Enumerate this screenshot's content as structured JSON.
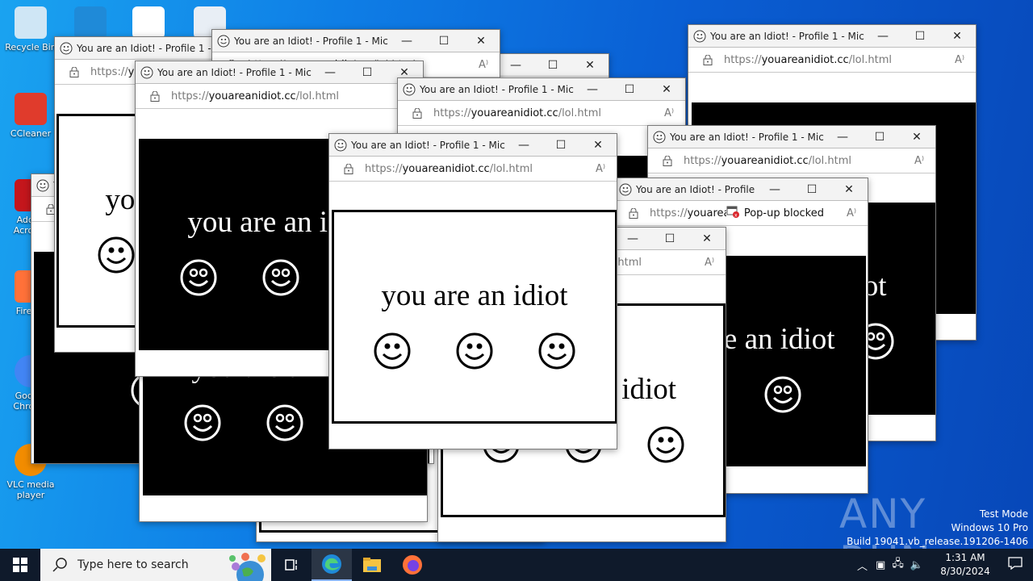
{
  "desktop": {
    "icons": [
      {
        "label": "Recycle Bin",
        "name": "recycle-bin"
      },
      {
        "label": "",
        "name": "microsoft-edge"
      },
      {
        "label": "",
        "name": "word-document"
      },
      {
        "label": "",
        "name": "image-file"
      },
      {
        "label": "CCleaner",
        "name": "ccleaner"
      },
      {
        "label": "Adobe Acrobat",
        "name": "adobe-acrobat"
      },
      {
        "label": "Firefox",
        "name": "firefox"
      },
      {
        "label": "Google Chrome",
        "name": "google-chrome"
      },
      {
        "label": "VLC media player",
        "name": "vlc-media-player"
      }
    ]
  },
  "windows": [
    {
      "title": "You are an Idiot! - Profile 1 - Micro...",
      "url_scheme": "https://",
      "url_domain": "youareanidiot.cc",
      "url_path": "/lol.html",
      "theme": "white",
      "text": "you are an idiot",
      "smileys": 3
    },
    {
      "title": "You are an Idiot! - Profile 1 - Micro...",
      "url_scheme": "https://",
      "url_domain": "youareanidiot.cc",
      "url_path": "/lol.html",
      "theme": "black",
      "text": "you are an idiot",
      "smileys": 3
    },
    {
      "title": "You are an Idiot! - Profile 1 - Micro...",
      "url_scheme": "https://",
      "url_domain": "youareanidiot.cc",
      "url_path": "/lol.html",
      "theme": "black",
      "text": "you are an idiot",
      "smileys": 3
    },
    {
      "title": "You are an Idiot! - Profile 1 - Micro...",
      "url_scheme": "https://",
      "url_domain": "youareanidiot.cc",
      "url_path": "/lol.html",
      "theme": "white",
      "text": "you are an idiot",
      "smileys": 3
    },
    {
      "title": "You are an Idiot! - Profile 1 - Micro...",
      "url_scheme": "https://",
      "url_domain": "youareanidiot.cc",
      "url_path": "/lol.html",
      "theme": "white",
      "text": "you are an idiot",
      "smileys": 3
    },
    {
      "title": "You are an Idiot! - Profile 1 - Micro...",
      "url_scheme": "https://",
      "url_domain": "youareanidiot.cc",
      "url_path": "/lol.html",
      "theme": "black",
      "text": "you are an idiot",
      "smileys": 3
    },
    {
      "title": "You are an Idiot! - Profile 1 - Micro...",
      "url_scheme": "https://",
      "url_domain": "youareanidiot.cc",
      "url_path": "/lol.html",
      "theme": "black",
      "text": "you are an idiot",
      "smileys": 3
    },
    {
      "title": "You are an Idiot! - Profile 1 - Micro...",
      "url_scheme": "https://",
      "url_domain": "youareanidiot.cc",
      "url_path": "/lol.html",
      "theme": "black",
      "text": "you are an idiot",
      "smileys": 3
    },
    {
      "title": "You are an Idiot! - Profile 1 - Micro...",
      "url_scheme": "https://",
      "url_domain": "youareanidiot.cc",
      "url_path": "/lol.html",
      "theme": "black",
      "text": "you are an idiot",
      "smileys": 3
    },
    {
      "title": "You are an Idiot! - Profile 1 - Micro...",
      "url_scheme": "https://",
      "url_domain": "youareanidiot.cc",
      "url_path": "/lol.html",
      "theme": "black",
      "text": "you are an idiot",
      "smileys": 3
    },
    {
      "title": "You are an Idiot! - Profile 1 - Micro...",
      "url_scheme": "https://",
      "url_domain": "youareani...",
      "url_path": "",
      "popup_blocked": "Pop-up blocked",
      "theme": "black",
      "text": "you are an idiot",
      "smileys": 2
    },
    {
      "title": "You are an Idiot! - Profile 1 - Micro...",
      "url_scheme": "https://",
      "url_domain": "youareanidiot.cc",
      "url_path": "/lol.html",
      "theme": "white",
      "text": "you are an idiot",
      "smileys": 3
    },
    {
      "title": "You are an Idiot! - Profile 1 - Micro...",
      "url_scheme": "https://",
      "url_domain": "youareanidiot.cc",
      "url_path": "/lol.html",
      "theme": "white",
      "text": "you are an idiot",
      "smileys": 3
    }
  ],
  "watermark": {
    "brand": "ANY RUN",
    "test_mode": "Test Mode",
    "edition": "Windows 10 Pro",
    "build": "Build 19041.vb_release.191206-1406"
  },
  "taskbar": {
    "search_placeholder": "Type here to search",
    "time": "1:31 AM",
    "date": "8/30/2024"
  }
}
